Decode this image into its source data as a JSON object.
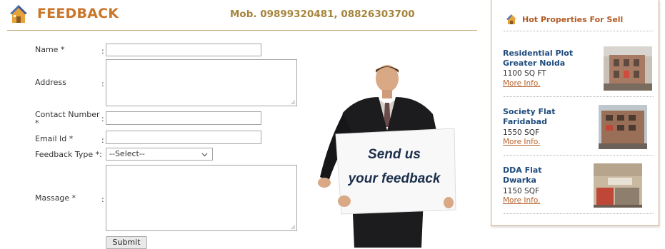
{
  "header": {
    "title": "FEEDBACK",
    "mobile": "Mob. 09899320481, 08826303700"
  },
  "form": {
    "name_label": "Name *",
    "address_label": "Address",
    "contact_label_line1": "Contact Number",
    "contact_label_line2": "*",
    "email_label": "Email Id *",
    "feedback_type_label": "Feedback Type *:",
    "message_label": "Massage *",
    "colon": ":",
    "feedback_type_selected": "--Select--",
    "submit_label": "Submit"
  },
  "banner": {
    "line1": "Send us",
    "line2": "your feedback"
  },
  "sidebar": {
    "title": "Hot Properties For Sell",
    "properties": [
      {
        "name_line1": "Residential Plot",
        "name_line2": "Greater Noida",
        "size": "1100 SQ FT",
        "more": "More Info."
      },
      {
        "name_line1": "Society Flat",
        "name_line2": "Faridabad",
        "size": "1550 SQF",
        "more": "More Info."
      },
      {
        "name_line1": "DDA Flat",
        "name_line2": "Dwarka",
        "size": "1150 SQF",
        "more": "More Info."
      }
    ]
  },
  "colors": {
    "accent_orange": "#c9752a",
    "mobile_gold": "#a5853c",
    "property_blue": "#1f4b7c",
    "link_orange": "#b7622d"
  }
}
